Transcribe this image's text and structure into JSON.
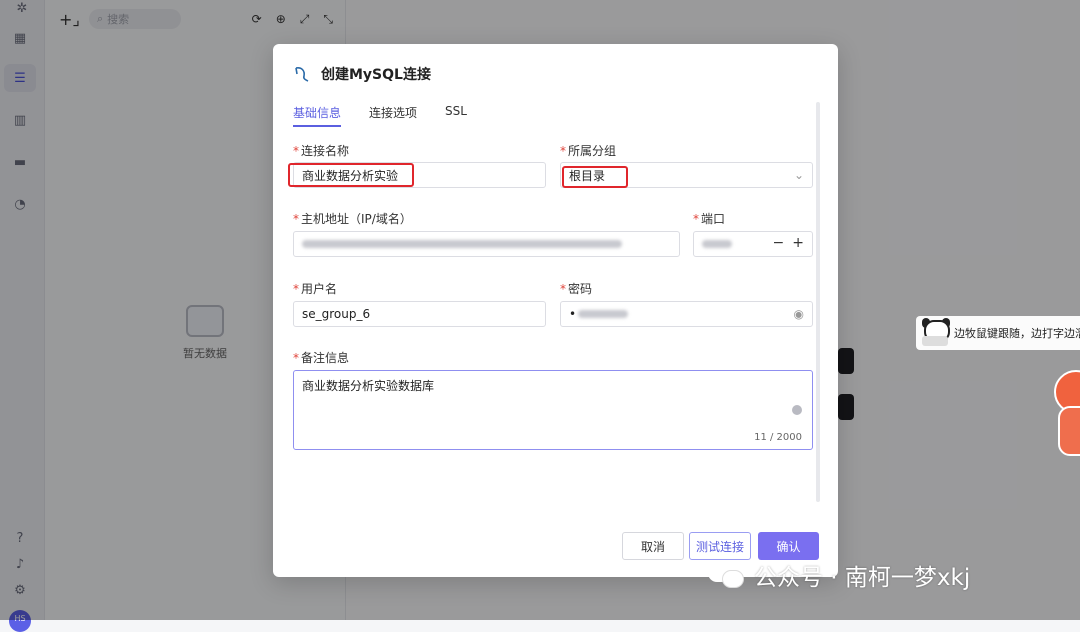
{
  "sidebar": {
    "icons": [
      "grid-icon",
      "database-icon",
      "chart-icon",
      "folder-icon",
      "clock-icon",
      "help-icon",
      "bell-icon",
      "settings-icon"
    ],
    "avatar_text": "HS"
  },
  "tree": {
    "search_placeholder": "搜索",
    "empty_text": "暂无数据"
  },
  "modal": {
    "title": "创建MySQL连接",
    "tabs": [
      "基础信息",
      "连接选项",
      "SSL"
    ],
    "active_tab": "基础信息",
    "fields": {
      "conn_name_label": "连接名称",
      "conn_name_value": "商业数据分析实验",
      "group_label": "所属分组",
      "group_value": "根目录",
      "host_label": "主机地址（IP/域名）",
      "port_label": "端口",
      "user_label": "用户名",
      "user_value": "se_group_6",
      "password_label": "密码",
      "password_value": "•",
      "note_label": "备注信息",
      "note_value": "商业数据分析实验数据库",
      "note_count": "11 / 2000"
    },
    "buttons": {
      "cancel": "取消",
      "test": "测试连接",
      "confirm": "确认"
    }
  },
  "stickers": {
    "note": "边牧鼠键跟随，边打字边溜"
  },
  "watermark": {
    "text": "公众号 · 南柯一梦xkj"
  },
  "colors": {
    "accent": "#5b5fe0",
    "confirm": "#7a6ff0",
    "highlight": "#e0262c",
    "required": "#e0443a"
  }
}
